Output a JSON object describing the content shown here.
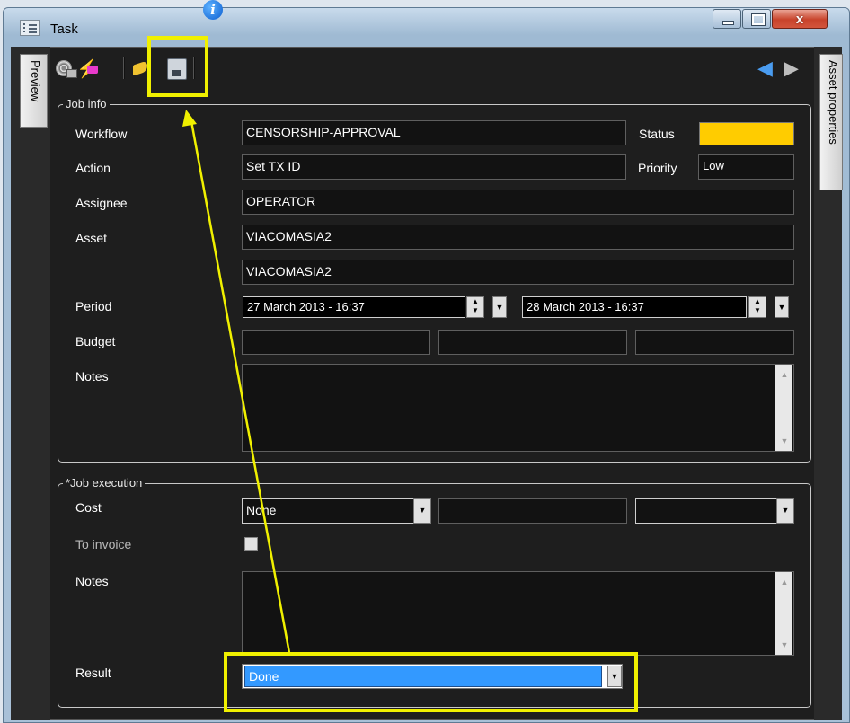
{
  "window": {
    "title": "Task",
    "close_label": "x"
  },
  "side_tabs": {
    "preview": "Preview",
    "asset_properties": "Asset properties"
  },
  "job_info": {
    "legend": "Job info",
    "workflow_label": "Workflow",
    "workflow_value": "CENSORSHIP-APPROVAL",
    "status_label": "Status",
    "status_color": "#ffcc00",
    "action_label": "Action",
    "action_value": "Set TX ID",
    "priority_label": "Priority",
    "priority_value": "Low",
    "assignee_label": "Assignee",
    "assignee_value": "OPERATOR",
    "asset_label": "Asset",
    "asset_value": "VIACOMASIA2",
    "asset_value_2": "VIACOMASIA2",
    "period_label": "Period",
    "period_start": "27 March 2013 - 16:37",
    "period_end": "28 March 2013 - 16:37",
    "budget_label": "Budget",
    "notes_label": "Notes"
  },
  "job_execution": {
    "legend": "*Job execution",
    "cost_label": "Cost",
    "cost_value": "None",
    "to_invoice_label": "To invoice",
    "to_invoice_checked": false,
    "notes_label": "Notes",
    "result_label": "Result",
    "result_value": "Done"
  },
  "annotation": {
    "highlight_color": "#f0f000"
  }
}
